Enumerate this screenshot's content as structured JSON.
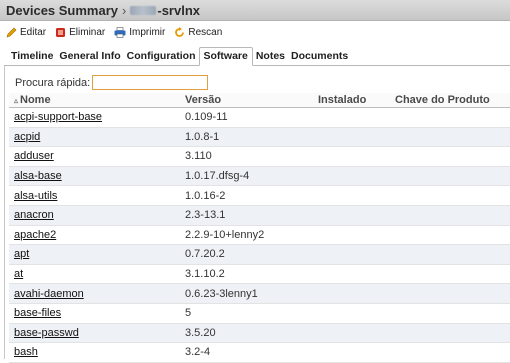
{
  "header": {
    "title": "Devices Summary",
    "separator": "›",
    "device_suffix": "-srvlnx"
  },
  "toolbar": {
    "edit_label": "Editar",
    "delete_label": "Eliminar",
    "print_label": "Imprimir",
    "rescan_label": "Rescan"
  },
  "tabs": [
    {
      "label": "Timeline"
    },
    {
      "label": "General Info"
    },
    {
      "label": "Configuration"
    },
    {
      "label": "Software",
      "active": true
    },
    {
      "label": "Notes"
    },
    {
      "label": "Documents"
    }
  ],
  "search": {
    "label": "Procura rápida:",
    "value": ""
  },
  "table": {
    "columns": [
      "Nome",
      "Versão",
      "Instalado",
      "Chave do Produto"
    ],
    "rows": [
      {
        "name": "acpi-support-base",
        "version": "0.109-11"
      },
      {
        "name": "acpid",
        "version": "1.0.8-1"
      },
      {
        "name": "adduser",
        "version": "3.110"
      },
      {
        "name": "alsa-base",
        "version": "1.0.17.dfsg-4"
      },
      {
        "name": "alsa-utils",
        "version": "1.0.16-2"
      },
      {
        "name": "anacron",
        "version": "2.3-13.1"
      },
      {
        "name": "apache2",
        "version": "2.2.9-10+lenny2"
      },
      {
        "name": "apt",
        "version": "0.7.20.2"
      },
      {
        "name": "at",
        "version": "3.1.10.2"
      },
      {
        "name": "avahi-daemon",
        "version": "0.6.23-3lenny1"
      },
      {
        "name": "base-files",
        "version": "5"
      },
      {
        "name": "base-passwd",
        "version": "3.5.20"
      },
      {
        "name": "bash",
        "version": "3.2-4"
      }
    ]
  },
  "colors": {
    "title_bar": "#cfcfcf",
    "row_alt": "#eef1f6",
    "search_border": "#e0a040",
    "edit_icon": "#e8a000",
    "delete_icon": "#cc2a1a",
    "print_icon": "#2c6cc0",
    "rescan_icon": "#e89b00"
  }
}
